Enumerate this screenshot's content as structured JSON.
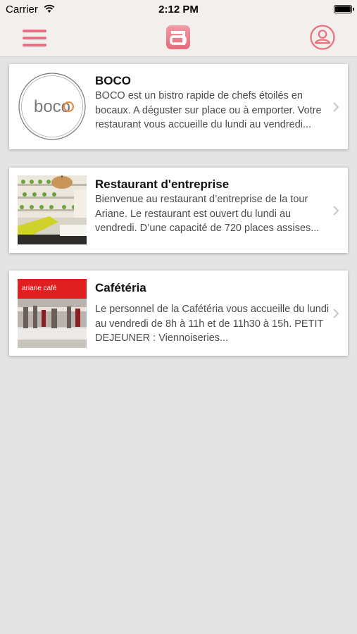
{
  "status_bar": {
    "carrier": "Carrier",
    "time": "2:12 PM"
  },
  "navbar": {
    "menu_icon": "hamburger-menu-icon",
    "logo_icon": "ariane-logo-icon",
    "profile_icon": "user-profile-icon",
    "accent_color": "#e87080"
  },
  "restaurants": [
    {
      "title": "BOCO",
      "logo_text": "boco",
      "description": "BOCO est un bistro rapide de chefs étoilés en bocaux. A déguster sur place ou à emporter. Votre restaurant vous accueille du lundi au vendredi..."
    },
    {
      "title": "Restaurant d'entreprise",
      "description": "Bienvenue au restaurant d’entreprise de la tour Ariane. Le restaurant est ouvert du lundi au vendredi. D’une capacité de 720 places assises..."
    },
    {
      "title": "Cafétéria",
      "sign_text": "ariane café",
      "description": "Le personnel de la Cafétéria vous accueille du lundi au vendredi de 8h à 11h et de 11h30 à 15h. PETIT DEJEUNER : Viennoiseries..."
    }
  ]
}
